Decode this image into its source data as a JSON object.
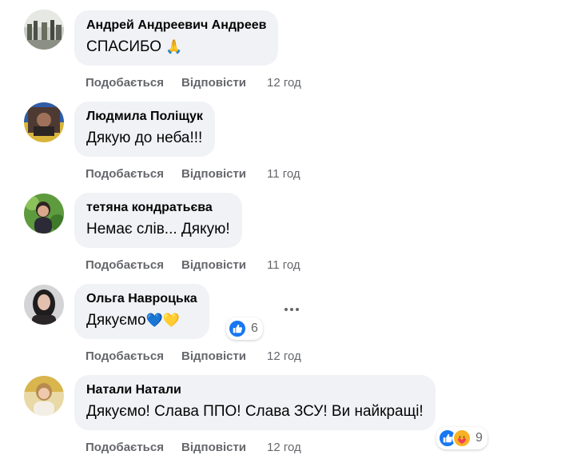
{
  "comments": [
    {
      "author": "Андрей Андреевич Андреев",
      "text": "СПАСИБО",
      "emoji": "🙏",
      "like_label": "Подобається",
      "reply_label": "Відповісти",
      "time": "12 год"
    },
    {
      "author": "Людмила Поліщук",
      "text": "Дякую до неба!!!",
      "like_label": "Подобається",
      "reply_label": "Відповісти",
      "time": "11 год"
    },
    {
      "author": "тетяна кондратьєва",
      "text": "Немає слів... Дякую!",
      "like_label": "Подобається",
      "reply_label": "Відповісти",
      "time": "11 год"
    },
    {
      "author": "Ольга Навроцька",
      "text": "Дякуємо",
      "emoji": "💙💛",
      "like_label": "Подобається",
      "reply_label": "Відповісти",
      "time": "12 год",
      "reaction_count": "6",
      "reactions": [
        "like-icon"
      ]
    },
    {
      "author": "Натали Натали",
      "text": "Дякуємо! Слава ППО! Слава ЗСУ! Ви найкращі!",
      "like_label": "Подобається",
      "reply_label": "Відповісти",
      "time": "12 год",
      "reaction_count": "9",
      "reactions": [
        "like-icon",
        "care-icon"
      ]
    }
  ],
  "colors": {
    "bubble": "#f0f2f5",
    "secondary_text": "#65676b",
    "like_blue": "#1877f2",
    "care_yellow": "#f7b125"
  }
}
